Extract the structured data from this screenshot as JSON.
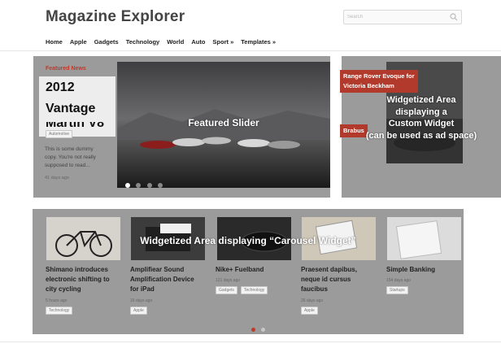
{
  "header": {
    "logo": "Magazine Explorer",
    "search_placeholder": "Search"
  },
  "nav": [
    "Home",
    "Apple",
    "Gadgets",
    "Technology",
    "World",
    "Auto",
    "Sport »",
    "Templates »"
  ],
  "featured": {
    "label": "Featured News",
    "title_line1": "2012 Aston Martin V8",
    "title_line2": "Vantage",
    "tag": "Automotive",
    "desc_lines": [
      "This is some dummy",
      "copy. You're not really",
      "supposed to read..."
    ],
    "time": "41 days ago",
    "overlay": "Featured Slider"
  },
  "side": {
    "label1_line1": "Range Rover Evoque for",
    "label1_line2": "Victoria Beckham",
    "label2": "Brabus",
    "overlay_lines": [
      "Widgetized Area",
      "displaying a",
      "Custom Widget",
      "(can be used as ad space)"
    ]
  },
  "carousel": {
    "overlay": "Widgetized Area displaying “Carousel Widget”",
    "cards": [
      {
        "title_lines": [
          "Shimano introduces",
          "electronic shifting to",
          "city cycling"
        ],
        "time": "5 hours ago",
        "tags": [
          "Technology"
        ]
      },
      {
        "title_lines": [
          "Amplifiear Sound",
          "Amplification Device",
          "for iPad"
        ],
        "time": "16 days ago",
        "tags": [
          "Apple"
        ]
      },
      {
        "title_lines": [
          "Nike+ Fuelband"
        ],
        "time": "121 days ago",
        "tags": [
          "Gadgets",
          "Technology"
        ]
      },
      {
        "title_lines": [
          "Praesent dapibus,",
          "neque id cursus",
          "faucibus"
        ],
        "time": "26 days ago",
        "tags": [
          "Apple"
        ]
      },
      {
        "title_lines": [
          "Simple Banking"
        ],
        "time": "154 days ago",
        "tags": [
          "Startups"
        ]
      }
    ]
  },
  "colors": {
    "accent": "#b23a2c",
    "overlay_gray": "#9b9b9b"
  }
}
